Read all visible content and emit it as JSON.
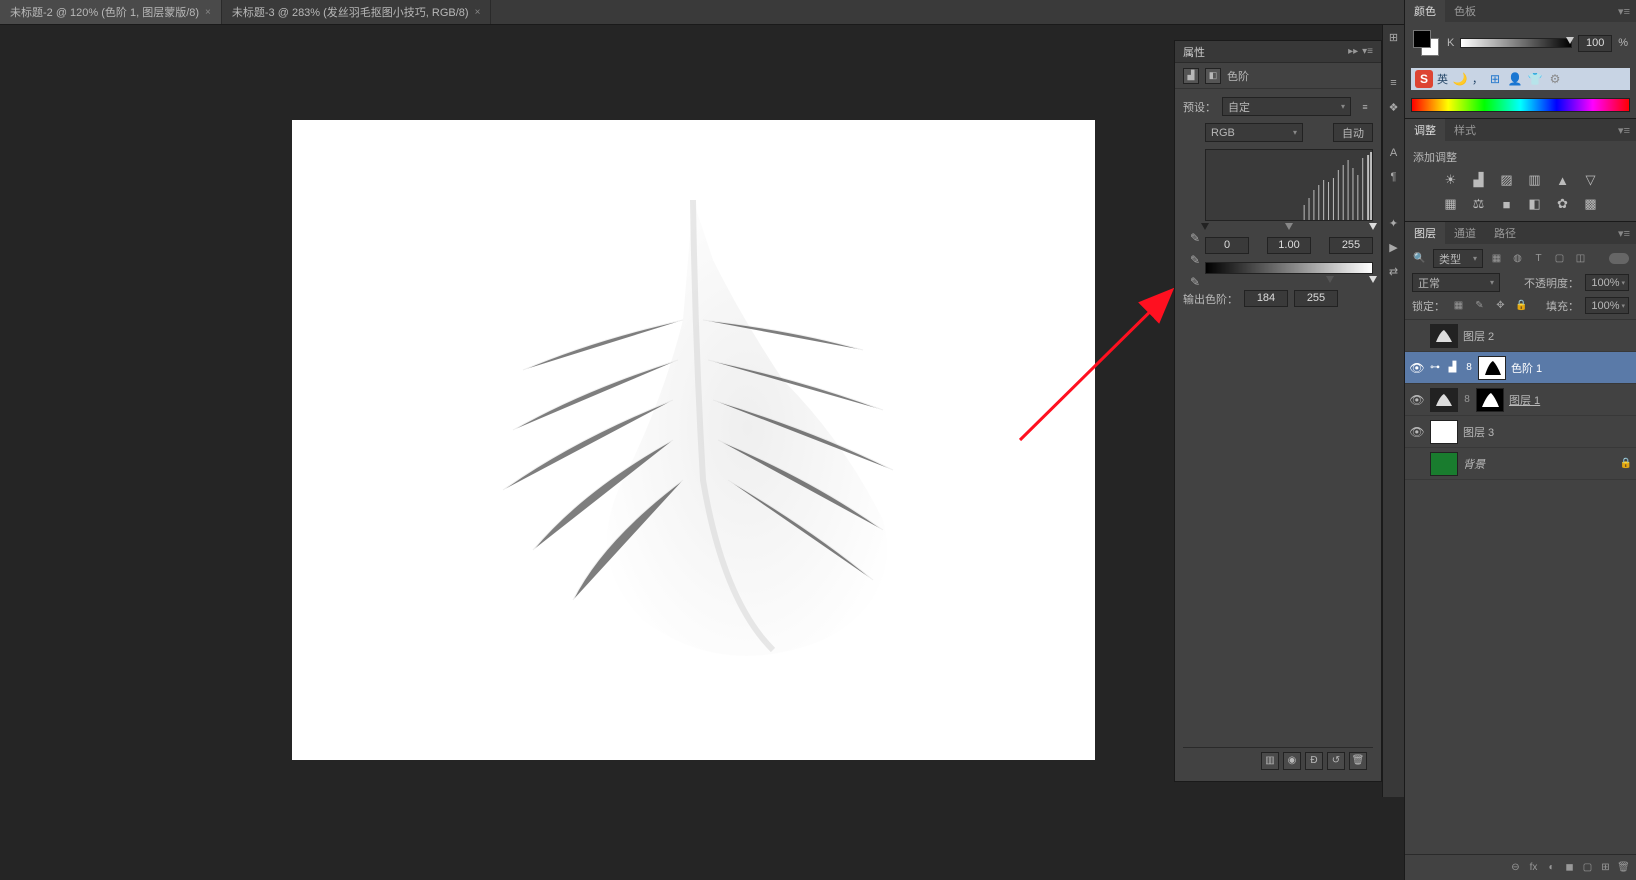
{
  "tabs": [
    {
      "label": "未标题-2 @ 120% (色阶 1, 图层蒙版/8)",
      "active": true
    },
    {
      "label": "未标题-3 @ 283% (发丝羽毛抠图小技巧, RGB/8)",
      "active": false
    }
  ],
  "properties": {
    "panel_title": "属性",
    "adj_name": "色阶",
    "preset_label": "预设：",
    "preset_value": "自定",
    "channel": "RGB",
    "auto": "自动",
    "input_black": "0",
    "input_mid": "1.00",
    "input_white": "255",
    "output_label": "输出色阶：",
    "output_low": "184",
    "output_high": "255"
  },
  "right_tools": [
    "⊞",
    "≡",
    "❖",
    "━",
    "A",
    "¶",
    "━",
    "✦",
    "▶",
    "⇄"
  ],
  "color_panel": {
    "tab1": "颜色",
    "tab2": "色板",
    "k_label": "K",
    "k_value": "100",
    "k_unit": "%"
  },
  "ime": {
    "logo": "S",
    "lang": "英",
    "moon": "🌙",
    "comma": "，",
    "items": [
      "⊞",
      "👤",
      "👕",
      "⚙"
    ]
  },
  "adjustments": {
    "tab1": "调整",
    "tab2": "样式",
    "heading": "添加调整",
    "row1": [
      "☀",
      "▟",
      "▨",
      "▥",
      "▲",
      "▽"
    ],
    "row2": [
      "▦",
      "⚖",
      "■",
      "◧",
      "✿",
      "▩"
    ]
  },
  "layers": {
    "tabs": [
      "图层",
      "通道",
      "路径"
    ],
    "kind_label": "类型",
    "kind_icons": [
      "▦",
      "◍",
      "T",
      "▢",
      "◫"
    ],
    "blend": "正常",
    "opacity_label": "不透明度：",
    "opacity": "100%",
    "lock_label": "锁定：",
    "lock_icons": [
      "▦",
      "✎",
      "✥",
      "🔒"
    ],
    "fill_label": "填充：",
    "fill": "100%",
    "items": [
      {
        "eye": false,
        "thumbs": [
          "feather"
        ],
        "name": "图层 2",
        "sel": false
      },
      {
        "eye": true,
        "pre": [
          "⊶",
          "▟",
          "8"
        ],
        "thumbs": [
          "mask"
        ],
        "name": "色阶 1",
        "sel": true
      },
      {
        "eye": true,
        "thumbs": [
          "feather",
          "mask2"
        ],
        "name": "图层 1",
        "sel": false,
        "underline": true
      },
      {
        "eye": true,
        "thumbs": [
          "white"
        ],
        "name": "图层 3",
        "sel": false
      },
      {
        "eye": false,
        "thumbs": [
          "green"
        ],
        "name": "背景",
        "sel": false,
        "italic": true,
        "locked": true
      }
    ],
    "foot": [
      "⊖",
      "fx",
      "◐",
      "◼",
      "▢",
      "⊞",
      "🗑"
    ]
  },
  "prop_foot": [
    "▥",
    "◉",
    "Ð",
    "↺",
    "🗑"
  ]
}
